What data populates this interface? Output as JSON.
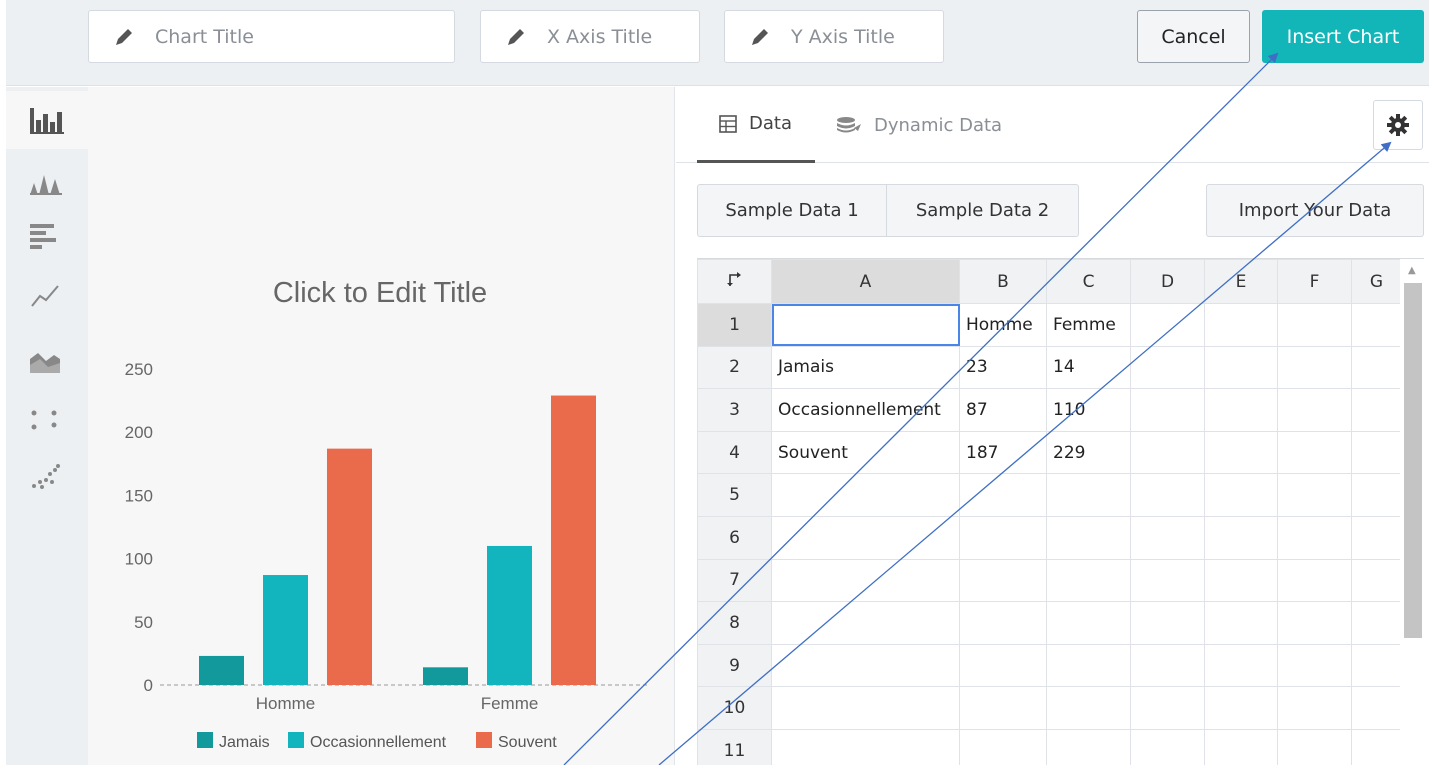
{
  "toolbar": {
    "chart_title_placeholder": "Chart Title",
    "x_axis_placeholder": "X Axis Title",
    "y_axis_placeholder": "Y Axis Title",
    "cancel_label": "Cancel",
    "insert_label": "Insert Chart"
  },
  "sidebar": {
    "items": [
      {
        "icon": "bar-chart-icon",
        "active": true
      },
      {
        "icon": "triangle-chart-icon",
        "active": false
      },
      {
        "icon": "horizontal-bar-icon",
        "active": false
      },
      {
        "icon": "line-chart-icon",
        "active": false
      },
      {
        "icon": "area-chart-icon",
        "active": false
      },
      {
        "icon": "scatter-icon",
        "active": false
      },
      {
        "icon": "bubble-scatter-icon",
        "active": false
      }
    ]
  },
  "tabs": {
    "data_label": "Data",
    "dynamic_label": "Dynamic Data",
    "active": "data"
  },
  "buttons": {
    "sample1": "Sample Data 1",
    "sample2": "Sample Data 2",
    "import": "Import Your Data"
  },
  "sheet": {
    "columns": [
      "A",
      "B",
      "C",
      "D",
      "E",
      "F",
      "G"
    ],
    "rows": [
      [
        "",
        "Homme",
        "Femme",
        "",
        "",
        "",
        ""
      ],
      [
        "Jamais",
        "23",
        "14",
        "",
        "",
        "",
        ""
      ],
      [
        "Occasionnellement",
        "87",
        "110",
        "",
        "",
        "",
        ""
      ],
      [
        "Souvent",
        "187",
        "229",
        "",
        "",
        "",
        ""
      ],
      [
        "",
        "",
        "",
        "",
        "",
        "",
        ""
      ],
      [
        "",
        "",
        "",
        "",
        "",
        "",
        ""
      ],
      [
        "",
        "",
        "",
        "",
        "",
        "",
        ""
      ],
      [
        "",
        "",
        "",
        "",
        "",
        "",
        ""
      ],
      [
        "",
        "",
        "",
        "",
        "",
        "",
        ""
      ],
      [
        "",
        "",
        "",
        "",
        "",
        "",
        ""
      ],
      [
        "",
        "",
        "",
        "",
        "",
        "",
        ""
      ]
    ],
    "row_numbers": [
      "1",
      "2",
      "3",
      "4",
      "5",
      "6",
      "7",
      "8",
      "9",
      "10",
      "11"
    ]
  },
  "colors": {
    "accent": "#12b5b8",
    "series_jamais": "#12999b",
    "series_occasionnellement": "#12b5bd",
    "series_souvent": "#e96b4c"
  },
  "chart_data": {
    "type": "bar",
    "title": "Click to Edit Title",
    "categories": [
      "Homme",
      "Femme"
    ],
    "series": [
      {
        "name": "Jamais",
        "values": [
          23,
          14
        ]
      },
      {
        "name": "Occasionnellement",
        "values": [
          87,
          110
        ]
      },
      {
        "name": "Souvent",
        "values": [
          187,
          229
        ]
      }
    ],
    "yticks": [
      0,
      50,
      100,
      150,
      200,
      250
    ],
    "ylim": [
      0,
      250
    ],
    "legend": "bottom",
    "grid": false
  }
}
